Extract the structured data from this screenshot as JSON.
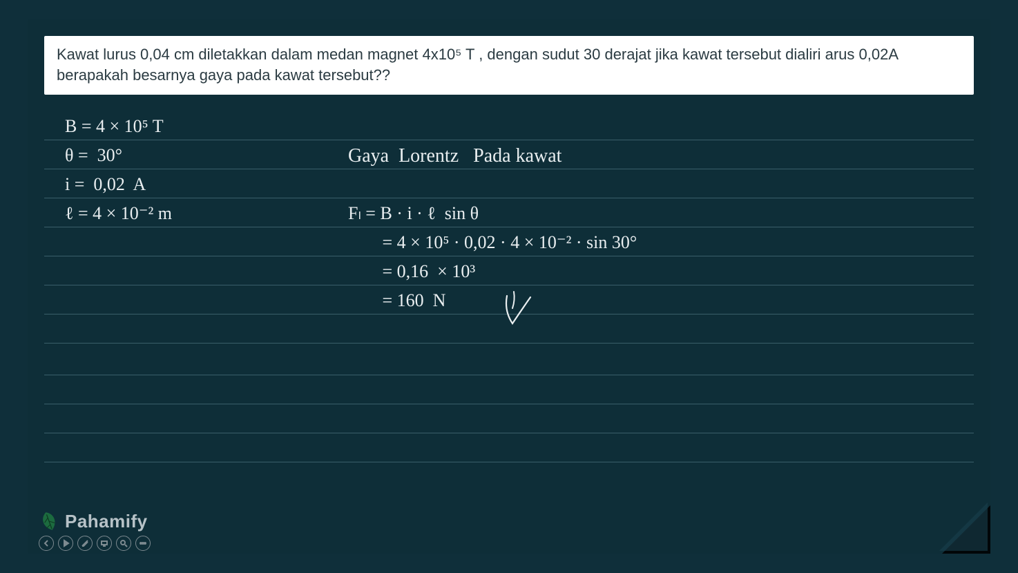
{
  "question": "Kawat lurus 0,04 cm diletakkan dalam medan magnet 4x10⁵ T , dengan sudut 30 derajat jika kawat tersebut dialiri arus 0,02A berapakah besarnya gaya pada kawat tersebut??",
  "work": {
    "l1": "B = 4 × 10⁵ T",
    "l2": "θ =  30°",
    "l3": "i =  0,02  A",
    "l4": "ℓ = 4 × 10⁻² m",
    "title": "Gaya  Lorentz   Pada kawat",
    "eq1": "Fₗ = B · i · ℓ  sin θ",
    "eq2": "   = 4 × 10⁵ · 0,02 · 4 × 10⁻² · sin 30°",
    "eq3": "   = 0,16  × 10³",
    "eq4": "   = 160  N"
  },
  "brand": "Pahamify"
}
